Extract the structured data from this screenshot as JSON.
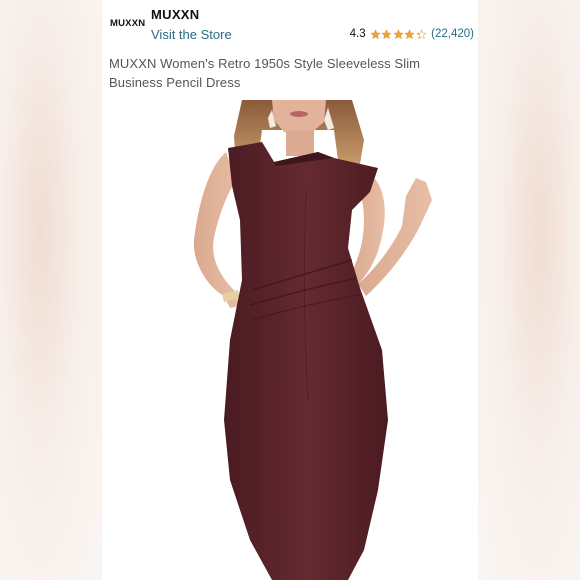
{
  "brand": {
    "logo_text": "MUXXN",
    "name": "MUXXN",
    "visit_link": "Visit the Store"
  },
  "rating": {
    "value": "4.3",
    "stars": 4.3,
    "count": "(22,420)"
  },
  "product": {
    "title": "MUXXN Women's Retro 1950s Style Sleeveless Slim Business Pencil Dress",
    "dress_color": "#5a2329"
  },
  "colors": {
    "link": "#2a6c84",
    "star": "#f2a43a"
  }
}
